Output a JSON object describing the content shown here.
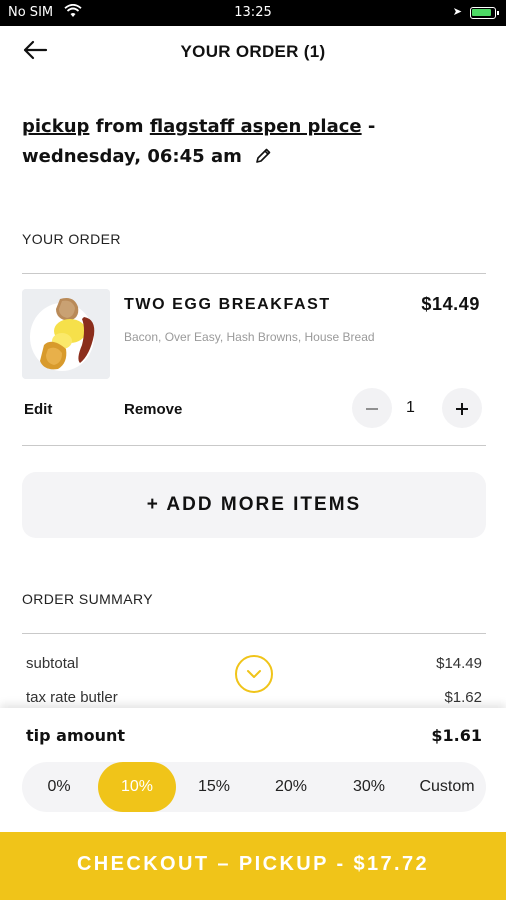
{
  "status_bar": {
    "carrier": "No SIM",
    "time": "13:25",
    "battery_level": 0.9
  },
  "header": {
    "title": "YOUR ORDER (1)",
    "back_icon": "back-arrow-icon"
  },
  "pickup": {
    "mode": "pickup",
    "from": "from",
    "location": "flagstaff aspen place",
    "separator": " -",
    "datetime": "wednesday, 06:45 am",
    "edit_icon": "pencil-icon"
  },
  "order": {
    "section_label": "YOUR ORDER",
    "items": [
      {
        "name": "TWO EGG BREAKFAST",
        "price": "$14.49",
        "modifiers": "Bacon, Over Easy, Hash Browns, House Bread",
        "quantity": "1",
        "edit_label": "Edit",
        "remove_label": "Remove"
      }
    ],
    "add_more_label": "+ ADD MORE ITEMS"
  },
  "summary": {
    "section_label": "ORDER SUMMARY",
    "rows": [
      {
        "label": "subtotal",
        "value": "$14.49"
      },
      {
        "label": "tax rate butler",
        "value": "$1.62"
      }
    ],
    "expand_icon": "chevron-down-icon"
  },
  "tip": {
    "label": "tip amount",
    "value": "$1.61",
    "options": [
      "0%",
      "10%",
      "15%",
      "20%",
      "30%",
      "Custom"
    ],
    "selected": "10%"
  },
  "checkout": {
    "label": "CHECKOUT – PICKUP - $17.72"
  },
  "colors": {
    "accent": "#f0c419",
    "muted_bg": "#f4f4f6",
    "divider": "#c9c9c9"
  }
}
